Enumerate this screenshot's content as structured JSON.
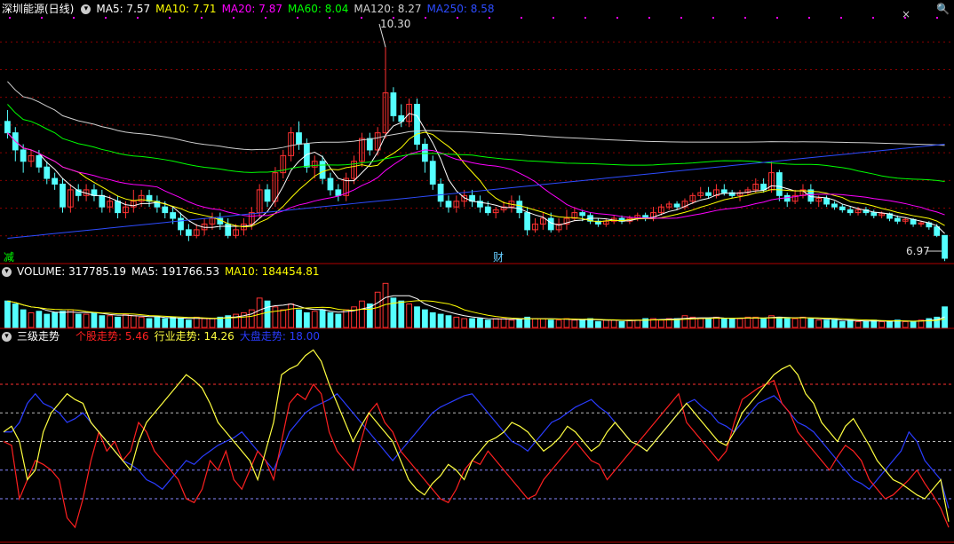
{
  "header": {
    "stock_name": "深圳能源(日线)",
    "ma": [
      {
        "label": "MA5: 7.57",
        "color": "#ffffff"
      },
      {
        "label": "MA10: 7.71",
        "color": "#ffff00"
      },
      {
        "label": "MA20: 7.87",
        "color": "#ff00ff"
      },
      {
        "label": "MA60: 8.04",
        "color": "#00ff00"
      },
      {
        "label": "MA120: 8.27",
        "color": "#cfcfcf"
      },
      {
        "label": "MA250: 8.58",
        "color": "#2d4cff"
      }
    ]
  },
  "volume_header": {
    "label": "VOLUME: 317785.19",
    "ma5": "MA5: 191766.53",
    "ma10": "MA10: 184454.81"
  },
  "indicator_header": {
    "name": "三级走势",
    "stock": "个股走势: 5.46",
    "industry": "行业走势: 14.26",
    "market": "大盘走势: 18.00"
  },
  "annotations": {
    "high": "10.30",
    "low": "6.97",
    "left_mark": "减",
    "mid_mark": "财"
  },
  "colors": {
    "up": "#ff3232",
    "down": "#54ffff",
    "grid": "#8a0000",
    "ma5": "#ffffff",
    "ma10": "#ffff00",
    "ma20": "#ff00ff",
    "ma60": "#00ff00",
    "ma120": "#cfcfcf",
    "ma250": "#2d4cff",
    "stock": "#ff2020",
    "industry": "#ffff40",
    "market": "#2a3cff"
  },
  "chart_data": [
    {
      "type": "candlestick",
      "ylim": [
        6.6,
        10.6
      ],
      "candles": [
        [
          9.0,
          8.8,
          9.2,
          8.7
        ],
        [
          8.8,
          8.5,
          8.9,
          8.3
        ],
        [
          8.5,
          8.3,
          8.6,
          8.1
        ],
        [
          8.3,
          8.4,
          8.5,
          8.2
        ],
        [
          8.4,
          8.2,
          8.5,
          8.1
        ],
        [
          8.2,
          8.0,
          8.3,
          7.9
        ],
        [
          8.0,
          7.9,
          8.1,
          7.8
        ],
        [
          7.9,
          7.5,
          8.0,
          7.4
        ],
        [
          7.5,
          7.8,
          7.9,
          7.4
        ],
        [
          7.8,
          7.7,
          7.9,
          7.6
        ],
        [
          7.7,
          7.8,
          7.9,
          7.6
        ],
        [
          7.8,
          7.7,
          7.9,
          7.6
        ],
        [
          7.7,
          7.5,
          7.8,
          7.4
        ],
        [
          7.5,
          7.6,
          7.7,
          7.4
        ],
        [
          7.6,
          7.4,
          7.7,
          7.3
        ],
        [
          7.4,
          7.5,
          7.6,
          7.3
        ],
        [
          7.5,
          7.6,
          7.8,
          7.4
        ],
        [
          7.6,
          7.7,
          7.8,
          7.5
        ],
        [
          7.7,
          7.6,
          7.8,
          7.5
        ],
        [
          7.6,
          7.5,
          7.7,
          7.4
        ],
        [
          7.5,
          7.4,
          7.6,
          7.3
        ],
        [
          7.4,
          7.3,
          7.5,
          7.2
        ],
        [
          7.3,
          7.1,
          7.4,
          7.0
        ],
        [
          7.1,
          7.0,
          7.2,
          6.9
        ],
        [
          7.0,
          7.1,
          7.2,
          6.95
        ],
        [
          7.1,
          7.2,
          7.3,
          7.0
        ],
        [
          7.2,
          7.3,
          7.4,
          7.1
        ],
        [
          7.3,
          7.2,
          7.4,
          7.1
        ],
        [
          7.2,
          7.0,
          7.3,
          6.95
        ],
        [
          7.0,
          7.1,
          7.2,
          6.95
        ],
        [
          7.1,
          7.2,
          7.3,
          7.0
        ],
        [
          7.2,
          7.4,
          7.5,
          7.1
        ],
        [
          7.4,
          7.8,
          7.9,
          7.3
        ],
        [
          7.8,
          7.6,
          7.9,
          7.5
        ],
        [
          7.6,
          8.1,
          8.2,
          7.5
        ],
        [
          8.1,
          8.4,
          8.5,
          8.0
        ],
        [
          8.4,
          8.8,
          8.9,
          8.3
        ],
        [
          8.8,
          8.6,
          9.0,
          8.5
        ],
        [
          8.6,
          8.2,
          8.7,
          8.1
        ],
        [
          8.2,
          8.3,
          8.4,
          8.0
        ],
        [
          8.3,
          8.0,
          8.4,
          7.9
        ],
        [
          8.0,
          7.8,
          8.1,
          7.7
        ],
        [
          7.8,
          7.7,
          7.9,
          7.6
        ],
        [
          7.7,
          8.0,
          8.1,
          7.6
        ],
        [
          8.0,
          8.3,
          8.4,
          7.9
        ],
        [
          8.3,
          8.7,
          8.8,
          8.2
        ],
        [
          8.7,
          8.5,
          8.8,
          8.4
        ],
        [
          8.5,
          8.8,
          8.9,
          8.4
        ],
        [
          8.8,
          9.5,
          10.3,
          8.7
        ],
        [
          9.5,
          9.1,
          9.6,
          9.0
        ],
        [
          9.1,
          9.0,
          9.3,
          8.9
        ],
        [
          9.0,
          9.3,
          9.4,
          8.9
        ],
        [
          9.3,
          8.6,
          9.4,
          8.5
        ],
        [
          8.6,
          8.3,
          8.7,
          8.1
        ],
        [
          8.3,
          7.9,
          8.4,
          7.8
        ],
        [
          7.9,
          7.6,
          8.0,
          7.5
        ],
        [
          7.6,
          7.5,
          7.7,
          7.4
        ],
        [
          7.5,
          7.6,
          7.7,
          7.4
        ],
        [
          7.6,
          7.7,
          7.8,
          7.5
        ],
        [
          7.7,
          7.6,
          7.8,
          7.5
        ],
        [
          7.6,
          7.5,
          7.7,
          7.4
        ],
        [
          7.5,
          7.4,
          7.6,
          7.35
        ],
        [
          7.4,
          7.45,
          7.5,
          7.3
        ],
        [
          7.45,
          7.5,
          7.6,
          7.4
        ],
        [
          7.5,
          7.6,
          7.7,
          7.4
        ],
        [
          7.6,
          7.4,
          7.7,
          7.3
        ],
        [
          7.4,
          7.1,
          7.5,
          7.0
        ],
        [
          7.1,
          7.2,
          7.3,
          7.05
        ],
        [
          7.2,
          7.3,
          7.4,
          7.1
        ],
        [
          7.3,
          7.1,
          7.4,
          7.05
        ],
        [
          7.1,
          7.2,
          7.3,
          7.05
        ],
        [
          7.2,
          7.3,
          7.45,
          7.1
        ],
        [
          7.3,
          7.4,
          7.5,
          7.25
        ],
        [
          7.4,
          7.35,
          7.45,
          7.25
        ],
        [
          7.35,
          7.25,
          7.4,
          7.2
        ],
        [
          7.25,
          7.2,
          7.3,
          7.15
        ],
        [
          7.2,
          7.25,
          7.3,
          7.15
        ],
        [
          7.25,
          7.3,
          7.35,
          7.2
        ],
        [
          7.3,
          7.25,
          7.35,
          7.2
        ],
        [
          7.25,
          7.3,
          7.35,
          7.2
        ],
        [
          7.3,
          7.35,
          7.4,
          7.25
        ],
        [
          7.35,
          7.3,
          7.4,
          7.25
        ],
        [
          7.3,
          7.4,
          7.5,
          7.25
        ],
        [
          7.4,
          7.5,
          7.55,
          7.35
        ],
        [
          7.5,
          7.55,
          7.6,
          7.45
        ],
        [
          7.55,
          7.5,
          7.6,
          7.45
        ],
        [
          7.5,
          7.6,
          7.65,
          7.45
        ],
        [
          7.6,
          7.7,
          7.75,
          7.55
        ],
        [
          7.7,
          7.75,
          7.85,
          7.65
        ],
        [
          7.75,
          7.7,
          7.85,
          7.65
        ],
        [
          7.7,
          7.8,
          7.9,
          7.65
        ],
        [
          7.8,
          7.75,
          7.9,
          7.7
        ],
        [
          7.75,
          7.7,
          7.8,
          7.65
        ],
        [
          7.7,
          7.75,
          7.8,
          7.6
        ],
        [
          7.75,
          7.8,
          7.85,
          7.7
        ],
        [
          7.8,
          7.9,
          8.0,
          7.75
        ],
        [
          7.9,
          7.8,
          8.0,
          7.75
        ],
        [
          7.8,
          8.1,
          8.3,
          7.75
        ],
        [
          8.1,
          7.7,
          8.15,
          7.6
        ],
        [
          7.7,
          7.6,
          7.75,
          7.5
        ],
        [
          7.6,
          7.7,
          7.8,
          7.55
        ],
        [
          7.7,
          7.8,
          7.9,
          7.65
        ],
        [
          7.8,
          7.6,
          7.9,
          7.55
        ],
        [
          7.6,
          7.65,
          7.7,
          7.5
        ],
        [
          7.65,
          7.55,
          7.7,
          7.5
        ],
        [
          7.55,
          7.5,
          7.6,
          7.45
        ],
        [
          7.5,
          7.45,
          7.55,
          7.4
        ],
        [
          7.45,
          7.4,
          7.5,
          7.35
        ],
        [
          7.4,
          7.45,
          7.5,
          7.35
        ],
        [
          7.45,
          7.4,
          7.5,
          7.35
        ],
        [
          7.4,
          7.35,
          7.45,
          7.3
        ],
        [
          7.35,
          7.38,
          7.42,
          7.3
        ],
        [
          7.38,
          7.3,
          7.4,
          7.25
        ],
        [
          7.3,
          7.25,
          7.35,
          7.2
        ],
        [
          7.25,
          7.28,
          7.32,
          7.2
        ],
        [
          7.28,
          7.2,
          7.3,
          7.15
        ],
        [
          7.2,
          7.22,
          7.26,
          7.15
        ],
        [
          7.22,
          7.15,
          7.25,
          7.1
        ],
        [
          7.15,
          7.0,
          7.2,
          6.97
        ],
        [
          7.0,
          6.6,
          7.0,
          6.55
        ]
      ]
    },
    {
      "type": "bar",
      "values": [
        0.9,
        0.8,
        0.6,
        0.5,
        0.55,
        0.45,
        0.5,
        0.55,
        0.6,
        0.45,
        0.45,
        0.5,
        0.4,
        0.4,
        0.35,
        0.45,
        0.4,
        0.35,
        0.3,
        0.35,
        0.3,
        0.35,
        0.3,
        0.25,
        0.35,
        0.3,
        0.3,
        0.35,
        0.4,
        0.45,
        0.5,
        0.6,
        1.0,
        0.9,
        0.7,
        0.6,
        0.8,
        0.6,
        0.5,
        0.55,
        0.6,
        0.5,
        0.45,
        0.6,
        0.7,
        0.9,
        0.8,
        1.2,
        1.5,
        1.0,
        0.9,
        0.8,
        0.7,
        0.6,
        0.5,
        0.45,
        0.4,
        0.35,
        0.3,
        0.3,
        0.3,
        0.25,
        0.3,
        0.3,
        0.25,
        0.3,
        0.35,
        0.3,
        0.3,
        0.25,
        0.25,
        0.3,
        0.25,
        0.25,
        0.3,
        0.2,
        0.25,
        0.25,
        0.2,
        0.25,
        0.25,
        0.3,
        0.3,
        0.25,
        0.3,
        0.3,
        0.4,
        0.35,
        0.3,
        0.3,
        0.35,
        0.3,
        0.3,
        0.3,
        0.35,
        0.35,
        0.3,
        0.4,
        0.35,
        0.3,
        0.3,
        0.35,
        0.3,
        0.25,
        0.25,
        0.25,
        0.2,
        0.25,
        0.2,
        0.2,
        0.25,
        0.2,
        0.2,
        0.25,
        0.2,
        0.2,
        0.25,
        0.3,
        0.35,
        0.7
      ]
    },
    {
      "type": "line",
      "ylim": [
        0,
        100
      ],
      "grid_levels": [
        20,
        50,
        80
      ],
      "series": [
        {
          "name": "个股走势",
          "values": [
            50,
            48,
            20,
            30,
            40,
            38,
            35,
            30,
            10,
            5,
            20,
            40,
            55,
            45,
            50,
            40,
            45,
            60,
            55,
            45,
            40,
            35,
            30,
            20,
            18,
            25,
            40,
            35,
            45,
            30,
            25,
            35,
            45,
            40,
            30,
            50,
            70,
            75,
            72,
            80,
            75,
            55,
            45,
            40,
            35,
            50,
            65,
            70,
            60,
            55,
            45,
            40,
            35,
            30,
            25,
            20,
            18,
            25,
            35,
            40,
            38,
            45,
            40,
            35,
            30,
            25,
            20,
            22,
            30,
            35,
            40,
            45,
            50,
            45,
            40,
            38,
            30,
            35,
            40,
            45,
            50,
            55,
            60,
            65,
            70,
            75,
            60,
            55,
            50,
            45,
            40,
            45,
            60,
            72,
            75,
            78,
            80,
            82,
            70,
            65,
            55,
            50,
            45,
            40,
            35,
            42,
            48,
            45,
            40,
            30,
            25,
            20,
            22,
            26,
            30,
            35,
            28,
            22,
            15,
            5
          ]
        },
        {
          "name": "行业走势",
          "values": [
            55,
            58,
            50,
            30,
            35,
            55,
            65,
            70,
            75,
            72,
            70,
            60,
            55,
            50,
            45,
            40,
            35,
            50,
            60,
            65,
            70,
            75,
            80,
            85,
            82,
            78,
            70,
            60,
            55,
            50,
            45,
            40,
            30,
            45,
            60,
            85,
            88,
            90,
            95,
            98,
            92,
            80,
            70,
            60,
            50,
            58,
            65,
            60,
            55,
            50,
            40,
            30,
            25,
            22,
            28,
            32,
            38,
            35,
            30,
            40,
            45,
            50,
            52,
            55,
            60,
            58,
            55,
            50,
            45,
            48,
            52,
            58,
            55,
            50,
            45,
            48,
            55,
            60,
            55,
            50,
            48,
            45,
            50,
            55,
            60,
            65,
            70,
            65,
            60,
            55,
            50,
            48,
            55,
            65,
            70,
            75,
            80,
            85,
            88,
            90,
            85,
            75,
            70,
            60,
            55,
            50,
            58,
            62,
            55,
            48,
            40,
            35,
            30,
            28,
            25,
            22,
            20,
            25,
            30,
            8
          ]
        },
        {
          "name": "大盘走势",
          "values": [
            55,
            55,
            60,
            70,
            75,
            70,
            68,
            65,
            60,
            62,
            65,
            60,
            55,
            50,
            45,
            40,
            38,
            35,
            30,
            28,
            25,
            30,
            35,
            40,
            38,
            42,
            45,
            48,
            50,
            52,
            55,
            50,
            45,
            40,
            35,
            45,
            55,
            60,
            65,
            68,
            70,
            72,
            75,
            70,
            65,
            60,
            55,
            50,
            45,
            40,
            45,
            50,
            55,
            60,
            65,
            68,
            70,
            72,
            74,
            75,
            70,
            65,
            60,
            55,
            50,
            48,
            45,
            50,
            55,
            60,
            62,
            65,
            68,
            70,
            72,
            68,
            65,
            60,
            55,
            50,
            48,
            45,
            50,
            55,
            60,
            65,
            70,
            72,
            68,
            65,
            60,
            58,
            55,
            60,
            65,
            70,
            72,
            74,
            70,
            65,
            60,
            58,
            55,
            50,
            45,
            40,
            35,
            30,
            28,
            25,
            30,
            35,
            40,
            45,
            55,
            50,
            40,
            35,
            30,
            15
          ]
        }
      ]
    }
  ]
}
